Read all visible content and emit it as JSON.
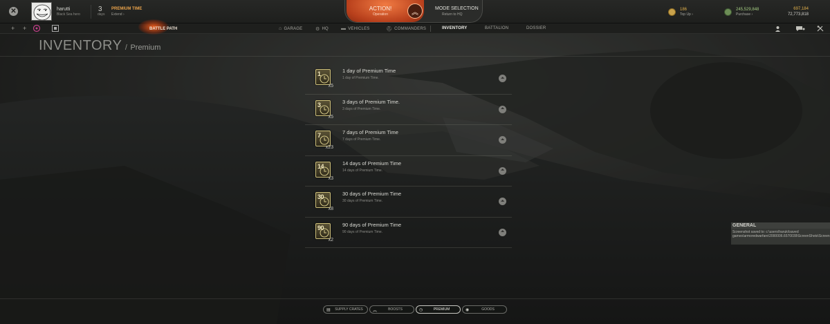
{
  "player": {
    "name": "harutti",
    "title": "Black Sea hero"
  },
  "premium_status": {
    "days": "3",
    "days_label": "days",
    "label": "PREMIUM TIME",
    "extend_label": "Extend"
  },
  "action": {
    "label": "ACTION!",
    "sub": "Operation"
  },
  "mode": {
    "label": "MODE SELECTION",
    "sub": "Return to HQ"
  },
  "currencies": {
    "gold": {
      "value": "186",
      "link": "Top Up"
    },
    "silver": {
      "value": "245,529,848",
      "link": "Purchase"
    },
    "xp": "697,184",
    "free_xp": "72,773,818"
  },
  "nav": {
    "battle_path": "BATTLE PATH",
    "items": [
      {
        "label": "GARAGE",
        "icon": "garage-icon",
        "active": false
      },
      {
        "label": "HQ",
        "icon": "hq-icon",
        "active": false
      },
      {
        "label": "VEHICLES",
        "icon": "tank-icon",
        "active": false
      },
      {
        "label": "COMMANDERS",
        "icon": "commanders-icon",
        "active": false
      },
      {
        "label": "INVENTORY",
        "icon": "",
        "active": true
      },
      {
        "label": "BATTALION",
        "icon": "",
        "active": false
      },
      {
        "label": "DOSSIER",
        "icon": "",
        "active": false
      }
    ]
  },
  "page": {
    "title": "INVENTORY",
    "separator": "/",
    "subtitle": "Premium"
  },
  "inventory": [
    {
      "icon_number": "1",
      "count": "x5",
      "name": "1 day of Premium Time",
      "description": "1 day of Premium Time."
    },
    {
      "icon_number": "3",
      "count": "x5",
      "name": "3 days of Premium Time.",
      "description": "3 days of Premium Time."
    },
    {
      "icon_number": "7",
      "count": "x23",
      "name": "7 days of Premium Time",
      "description": "7 days of Premium Time."
    },
    {
      "icon_number": "14",
      "count": "x3",
      "name": "14 days of Premium Time",
      "description": "14 days of Premium Time."
    },
    {
      "icon_number": "30",
      "count": "x8",
      "name": "30 days of Premium Time",
      "description": "30 days of Premium Time."
    },
    {
      "icon_number": "90",
      "count": "x2",
      "name": "90 days of Premium Time",
      "description": "90 days of Premium Time."
    }
  ],
  "notification": {
    "header": "GENERAL",
    "body": "Screenshot saved to: c:\\users\\haruki\\saved games\\armoredwarfare\\2000006.6570039\\ScreenShots\\ScreenShot0006.jpg"
  },
  "bottom_tabs": [
    {
      "label": "SUPPLY CRATES",
      "icon": "crate-icon",
      "active": false
    },
    {
      "label": "BOOSTS",
      "icon": "boost-icon",
      "active": false
    },
    {
      "label": "PREMIUM",
      "icon": "premium-clock-icon",
      "active": true
    },
    {
      "label": "GOODS",
      "icon": "goods-icon",
      "active": false
    }
  ],
  "colors": {
    "accent_orange": "#e85a1b",
    "premium_gold": "#e7a14a",
    "silver_green": "#a4cc82",
    "item_border": "#cdbf7a"
  }
}
